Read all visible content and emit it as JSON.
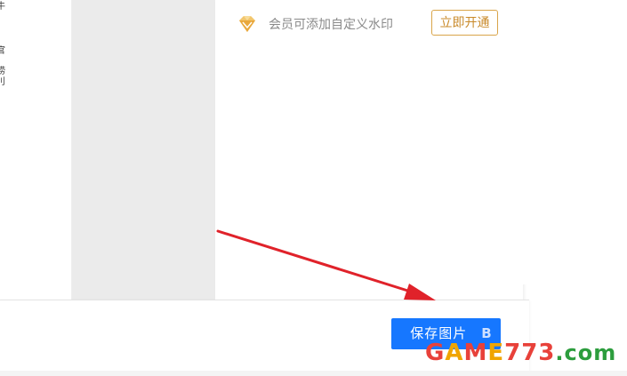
{
  "left_fragments": [
    "牛",
    "官",
    "捞",
    "刂"
  ],
  "vip": {
    "icon": "diamond-icon",
    "text": "会员可添加自定义水印",
    "button_label": "立即开通",
    "button_color": "#c98a2a"
  },
  "save": {
    "label": "保存图片",
    "suffix": "B",
    "color": "#1677ff"
  },
  "watermark": {
    "part1": "G",
    "part2": "A",
    "part3": "M",
    "part4": "E",
    "part5": "773",
    "part6": ".com"
  },
  "annotation": {
    "arrow_color": "#e0222a"
  }
}
